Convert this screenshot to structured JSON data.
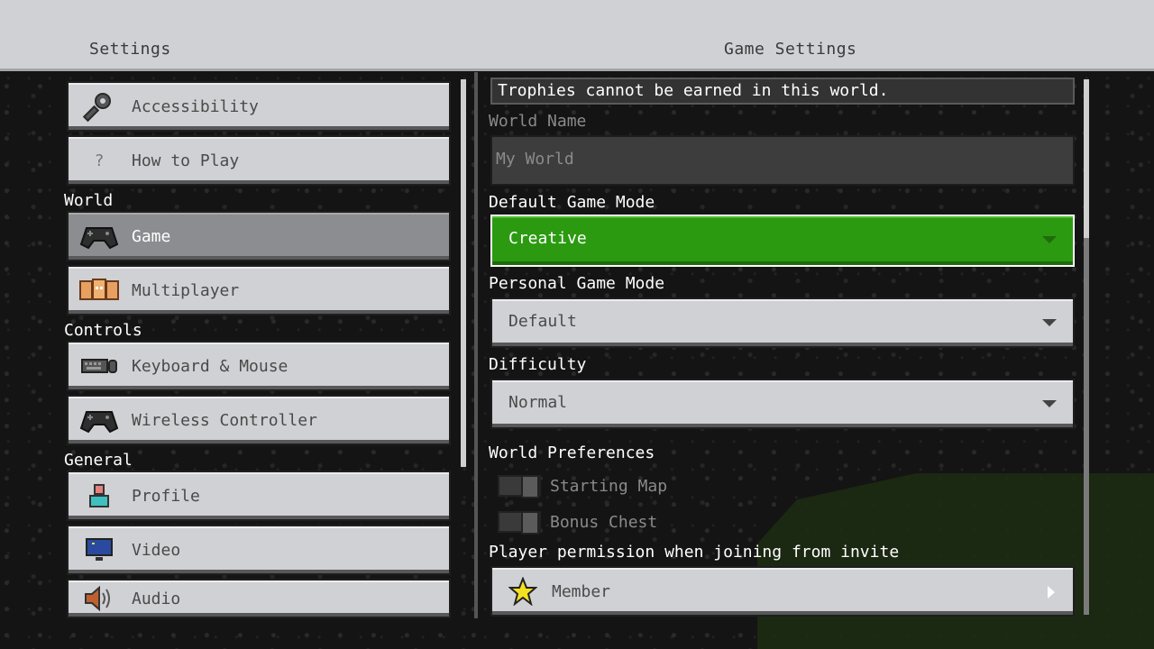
{
  "header": {
    "left_title": "Settings",
    "right_title": "Game Settings"
  },
  "nav": {
    "top_items": [
      {
        "label": "Accessibility",
        "icon": "key-icon"
      },
      {
        "label": "How to Play",
        "icon": "question-icon"
      }
    ],
    "sections": {
      "world": "World",
      "controls": "Controls",
      "general": "General"
    },
    "world_items": [
      {
        "label": "Game",
        "icon": "controller-icon",
        "active": true
      },
      {
        "label": "Multiplayer",
        "icon": "players-icon"
      }
    ],
    "controls_items": [
      {
        "label": "Keyboard & Mouse",
        "icon": "keyboard-icon"
      },
      {
        "label": "Wireless Controller",
        "icon": "controller-icon"
      }
    ],
    "general_items": [
      {
        "label": "Profile",
        "icon": "profile-icon"
      },
      {
        "label": "Video",
        "icon": "monitor-icon"
      },
      {
        "label": "Audio",
        "icon": "speaker-icon"
      }
    ],
    "question_glyph": "?"
  },
  "game": {
    "notice": "Trophies cannot be earned in this world.",
    "world_name_label": "World Name",
    "world_name_value": "My World",
    "default_mode_label": "Default Game Mode",
    "default_mode_value": "Creative",
    "personal_mode_label": "Personal Game Mode",
    "personal_mode_value": "Default",
    "difficulty_label": "Difficulty",
    "difficulty_value": "Normal",
    "world_prefs_label": "World Preferences",
    "starting_map_label": "Starting Map",
    "bonus_chest_label": "Bonus Chest",
    "permission_label": "Player permission when joining from invite",
    "permission_value": "Member"
  },
  "colors": {
    "accent_green": "#2b9a11",
    "button_gray": "#d0d1d4",
    "active_gray": "#8c8d90"
  }
}
